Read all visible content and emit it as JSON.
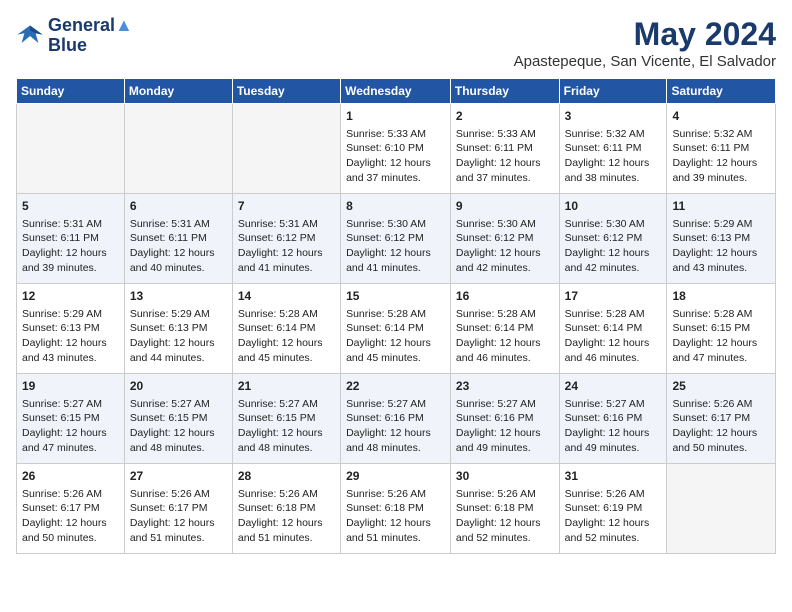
{
  "header": {
    "logo_line1": "General",
    "logo_line2": "Blue",
    "month_year": "May 2024",
    "location": "Apastepeque, San Vicente, El Salvador"
  },
  "weekdays": [
    "Sunday",
    "Monday",
    "Tuesday",
    "Wednesday",
    "Thursday",
    "Friday",
    "Saturday"
  ],
  "weeks": [
    [
      {
        "day": "",
        "info": ""
      },
      {
        "day": "",
        "info": ""
      },
      {
        "day": "",
        "info": ""
      },
      {
        "day": "1",
        "info": "Sunrise: 5:33 AM\nSunset: 6:10 PM\nDaylight: 12 hours\nand 37 minutes."
      },
      {
        "day": "2",
        "info": "Sunrise: 5:33 AM\nSunset: 6:11 PM\nDaylight: 12 hours\nand 37 minutes."
      },
      {
        "day": "3",
        "info": "Sunrise: 5:32 AM\nSunset: 6:11 PM\nDaylight: 12 hours\nand 38 minutes."
      },
      {
        "day": "4",
        "info": "Sunrise: 5:32 AM\nSunset: 6:11 PM\nDaylight: 12 hours\nand 39 minutes."
      }
    ],
    [
      {
        "day": "5",
        "info": "Sunrise: 5:31 AM\nSunset: 6:11 PM\nDaylight: 12 hours\nand 39 minutes."
      },
      {
        "day": "6",
        "info": "Sunrise: 5:31 AM\nSunset: 6:11 PM\nDaylight: 12 hours\nand 40 minutes."
      },
      {
        "day": "7",
        "info": "Sunrise: 5:31 AM\nSunset: 6:12 PM\nDaylight: 12 hours\nand 41 minutes."
      },
      {
        "day": "8",
        "info": "Sunrise: 5:30 AM\nSunset: 6:12 PM\nDaylight: 12 hours\nand 41 minutes."
      },
      {
        "day": "9",
        "info": "Sunrise: 5:30 AM\nSunset: 6:12 PM\nDaylight: 12 hours\nand 42 minutes."
      },
      {
        "day": "10",
        "info": "Sunrise: 5:30 AM\nSunset: 6:12 PM\nDaylight: 12 hours\nand 42 minutes."
      },
      {
        "day": "11",
        "info": "Sunrise: 5:29 AM\nSunset: 6:13 PM\nDaylight: 12 hours\nand 43 minutes."
      }
    ],
    [
      {
        "day": "12",
        "info": "Sunrise: 5:29 AM\nSunset: 6:13 PM\nDaylight: 12 hours\nand 43 minutes."
      },
      {
        "day": "13",
        "info": "Sunrise: 5:29 AM\nSunset: 6:13 PM\nDaylight: 12 hours\nand 44 minutes."
      },
      {
        "day": "14",
        "info": "Sunrise: 5:28 AM\nSunset: 6:14 PM\nDaylight: 12 hours\nand 45 minutes."
      },
      {
        "day": "15",
        "info": "Sunrise: 5:28 AM\nSunset: 6:14 PM\nDaylight: 12 hours\nand 45 minutes."
      },
      {
        "day": "16",
        "info": "Sunrise: 5:28 AM\nSunset: 6:14 PM\nDaylight: 12 hours\nand 46 minutes."
      },
      {
        "day": "17",
        "info": "Sunrise: 5:28 AM\nSunset: 6:14 PM\nDaylight: 12 hours\nand 46 minutes."
      },
      {
        "day": "18",
        "info": "Sunrise: 5:28 AM\nSunset: 6:15 PM\nDaylight: 12 hours\nand 47 minutes."
      }
    ],
    [
      {
        "day": "19",
        "info": "Sunrise: 5:27 AM\nSunset: 6:15 PM\nDaylight: 12 hours\nand 47 minutes."
      },
      {
        "day": "20",
        "info": "Sunrise: 5:27 AM\nSunset: 6:15 PM\nDaylight: 12 hours\nand 48 minutes."
      },
      {
        "day": "21",
        "info": "Sunrise: 5:27 AM\nSunset: 6:15 PM\nDaylight: 12 hours\nand 48 minutes."
      },
      {
        "day": "22",
        "info": "Sunrise: 5:27 AM\nSunset: 6:16 PM\nDaylight: 12 hours\nand 48 minutes."
      },
      {
        "day": "23",
        "info": "Sunrise: 5:27 AM\nSunset: 6:16 PM\nDaylight: 12 hours\nand 49 minutes."
      },
      {
        "day": "24",
        "info": "Sunrise: 5:27 AM\nSunset: 6:16 PM\nDaylight: 12 hours\nand 49 minutes."
      },
      {
        "day": "25",
        "info": "Sunrise: 5:26 AM\nSunset: 6:17 PM\nDaylight: 12 hours\nand 50 minutes."
      }
    ],
    [
      {
        "day": "26",
        "info": "Sunrise: 5:26 AM\nSunset: 6:17 PM\nDaylight: 12 hours\nand 50 minutes."
      },
      {
        "day": "27",
        "info": "Sunrise: 5:26 AM\nSunset: 6:17 PM\nDaylight: 12 hours\nand 51 minutes."
      },
      {
        "day": "28",
        "info": "Sunrise: 5:26 AM\nSunset: 6:18 PM\nDaylight: 12 hours\nand 51 minutes."
      },
      {
        "day": "29",
        "info": "Sunrise: 5:26 AM\nSunset: 6:18 PM\nDaylight: 12 hours\nand 51 minutes."
      },
      {
        "day": "30",
        "info": "Sunrise: 5:26 AM\nSunset: 6:18 PM\nDaylight: 12 hours\nand 52 minutes."
      },
      {
        "day": "31",
        "info": "Sunrise: 5:26 AM\nSunset: 6:19 PM\nDaylight: 12 hours\nand 52 minutes."
      },
      {
        "day": "",
        "info": ""
      }
    ]
  ]
}
